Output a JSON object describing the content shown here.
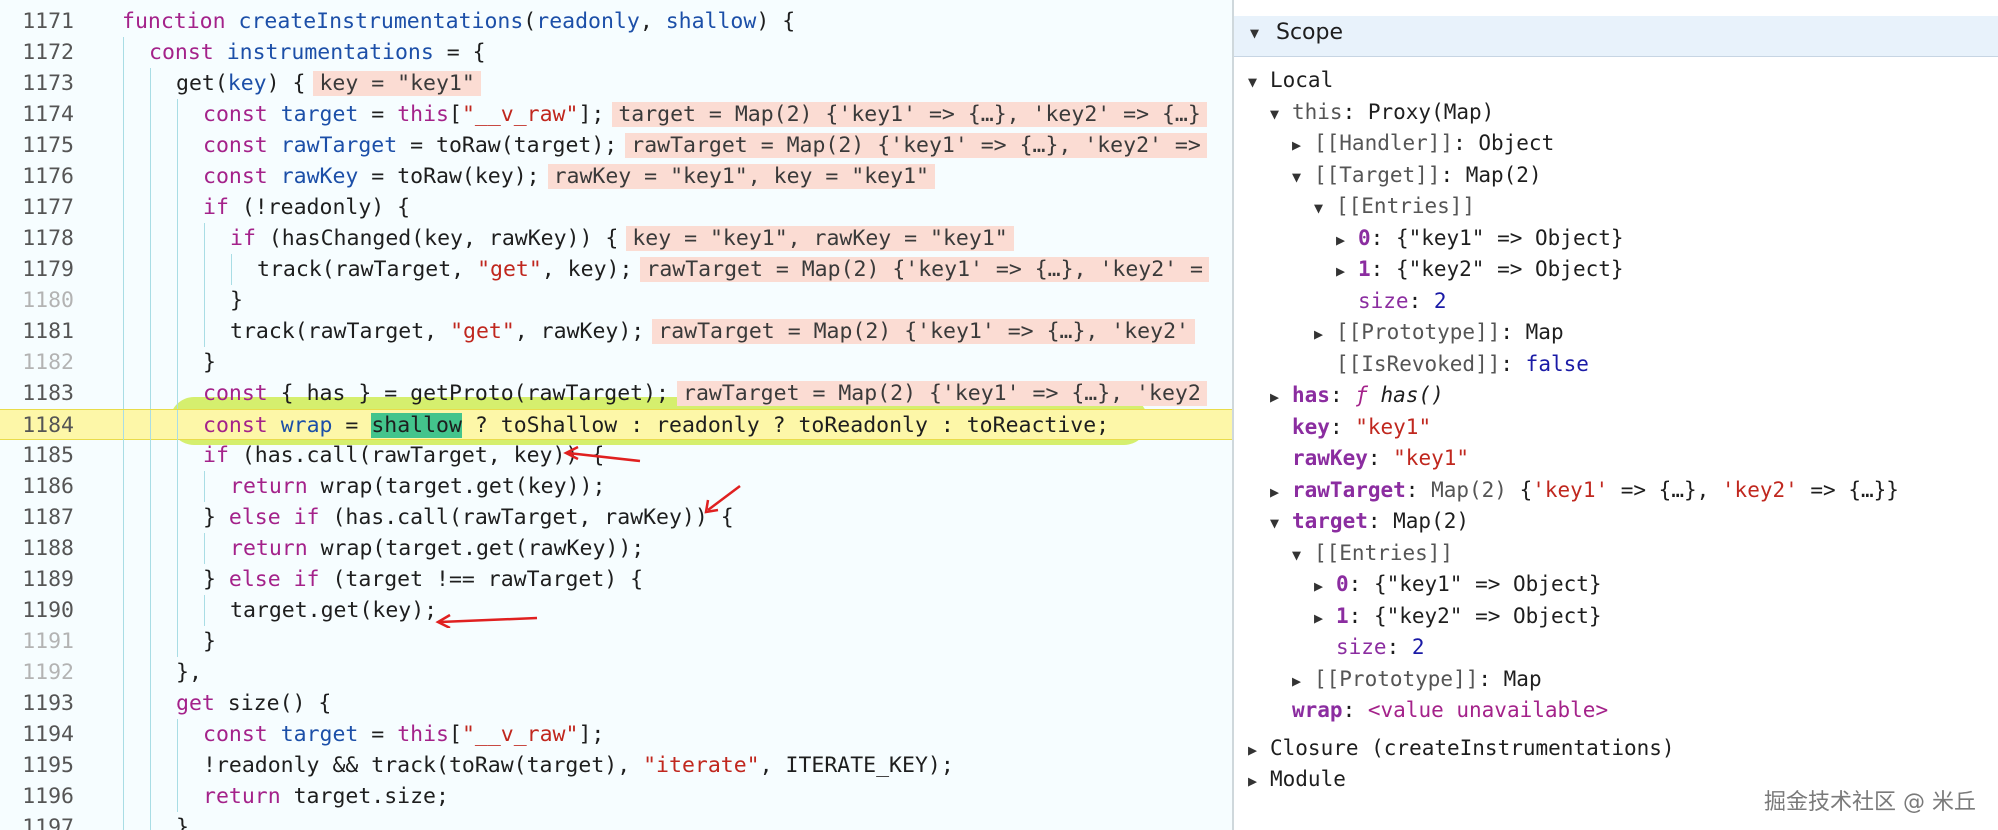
{
  "editor": {
    "lines": [
      {
        "n": "1171",
        "dim": false,
        "indent": 0,
        "html": "<span class='kw'>function</span> <span class='fn'>createInstrumentations</span>(<span class='fn'>readonly</span>, <span class='fn'>shallow</span>) {"
      },
      {
        "n": "1172",
        "dim": false,
        "indent": 1,
        "html": "<span class='kw'>const</span> <span class='fn'>instrumentations</span> = {"
      },
      {
        "n": "1173",
        "dim": false,
        "indent": 2,
        "html": "get(<span class='fn'>key</span>) {<span class='inl'>key = \"key1\"</span>"
      },
      {
        "n": "1174",
        "dim": false,
        "indent": 3,
        "html": "<span class='kw'>const</span> <span class='fn'>target</span> = <span class='kw'>this</span>[<span class='str'>\"__v_raw\"</span>];<span class='inl'>target = Map(2) {'key1' =&gt; {…}, 'key2' =&gt; {…}</span>"
      },
      {
        "n": "1175",
        "dim": false,
        "indent": 3,
        "html": "<span class='kw'>const</span> <span class='fn'>rawTarget</span> = toRaw(target);<span class='inl'>rawTarget = Map(2) {'key1' =&gt; {…}, 'key2' =&gt;</span>"
      },
      {
        "n": "1176",
        "dim": false,
        "indent": 3,
        "html": "<span class='kw'>const</span> <span class='fn'>rawKey</span> = toRaw(key);<span class='inl'>rawKey = \"key1\", key = \"key1\"</span>"
      },
      {
        "n": "1177",
        "dim": false,
        "indent": 3,
        "html": "<span class='kw'>if</span> (!readonly) {"
      },
      {
        "n": "1178",
        "dim": false,
        "indent": 4,
        "html": "<span class='kw'>if</span> (hasChanged(key, rawKey)) {<span class='inl'>key = \"key1\", rawKey = \"key1\"</span>"
      },
      {
        "n": "1179",
        "dim": false,
        "indent": 5,
        "html": "track(rawTarget, <span class='str'>\"get\"</span>, key);<span class='inl'>rawTarget = Map(2) {'key1' =&gt; {…}, 'key2' =</span>"
      },
      {
        "n": "1180",
        "dim": true,
        "indent": 4,
        "html": "}"
      },
      {
        "n": "1181",
        "dim": false,
        "indent": 4,
        "html": "track(rawTarget, <span class='str'>\"get\"</span>, rawKey);<span class='inl'>rawTarget = Map(2) {'key1' =&gt; {…}, 'key2'</span>"
      },
      {
        "n": "1182",
        "dim": true,
        "indent": 3,
        "html": "}"
      },
      {
        "n": "1183",
        "dim": false,
        "indent": 3,
        "html": "<span class='kw'>const</span> { has } = getProto(rawTarget);<span class='inl'>rawTarget = Map(2) {'key1' =&gt; {…}, 'key2</span>"
      },
      {
        "n": "1184",
        "dim": false,
        "indent": 3,
        "hl": true,
        "html": "<span class='kw'>const</span> <span class='fn'>wrap</span> = <span class='shallow-sel'>shallow</span> ? toShallow : readonly ? toReadonly : toReactive;"
      },
      {
        "n": "1185",
        "dim": false,
        "indent": 3,
        "html": "<span class='kw'>if</span> (has.call(rawTarget, key)) {"
      },
      {
        "n": "1186",
        "dim": false,
        "indent": 4,
        "html": "<span class='kw'>return</span> wrap(target.get(key));"
      },
      {
        "n": "1187",
        "dim": false,
        "indent": 3,
        "html": "} <span class='kw'>else if</span> (has.call(rawTarget, rawKey)) {"
      },
      {
        "n": "1188",
        "dim": false,
        "indent": 4,
        "html": "<span class='kw'>return</span> wrap(target.get(rawKey));"
      },
      {
        "n": "1189",
        "dim": false,
        "indent": 3,
        "html": "} <span class='kw'>else if</span> (target !== rawTarget) {"
      },
      {
        "n": "1190",
        "dim": false,
        "indent": 4,
        "html": "target.get(key);"
      },
      {
        "n": "1191",
        "dim": true,
        "indent": 3,
        "html": "}"
      },
      {
        "n": "1192",
        "dim": true,
        "indent": 2,
        "html": "},"
      },
      {
        "n": "1193",
        "dim": false,
        "indent": 2,
        "html": "<span class='kw'>get</span> size() {"
      },
      {
        "n": "1194",
        "dim": false,
        "indent": 3,
        "html": "<span class='kw'>const</span> <span class='fn'>target</span> = <span class='kw'>this</span>[<span class='str'>\"__v_raw\"</span>];"
      },
      {
        "n": "1195",
        "dim": false,
        "indent": 3,
        "html": "!readonly &amp;&amp; track(toRaw(target), <span class='str'>\"iterate\"</span>, ITERATE_KEY);"
      },
      {
        "n": "1196",
        "dim": false,
        "indent": 3,
        "html": "<span class='kw'>return</span> target.size;"
      },
      {
        "n": "1197",
        "dim": false,
        "indent": 2,
        "html": "},"
      }
    ]
  },
  "scope": {
    "header": "Scope",
    "rows": [
      {
        "indent": 0,
        "tri": "▼",
        "html": "Local"
      },
      {
        "indent": 1,
        "tri": "▼",
        "html": "<span class='gray'>this</span>: Proxy(Map)"
      },
      {
        "indent": 2,
        "tri": "▶",
        "html": "<span class='gray'>[[Handler]]</span>: Object"
      },
      {
        "indent": 2,
        "tri": "▼",
        "html": "<span class='gray'>[[Target]]</span>: Map(2)"
      },
      {
        "indent": 3,
        "tri": "▼",
        "html": "<span class='gray'>[[Entries]]</span>"
      },
      {
        "indent": 4,
        "tri": "▶",
        "html": "<span class='keyb'>0</span>: {\"key1\" =&gt; Object}"
      },
      {
        "indent": 4,
        "tri": "▶",
        "html": "<span class='keyb'>1</span>: {\"key2\" =&gt; Object}"
      },
      {
        "indent": 4,
        "tri": "",
        "html": "<span class='key'>size</span>: <span class='nval'>2</span>"
      },
      {
        "indent": 3,
        "tri": "▶",
        "html": "<span class='gray'>[[Prototype]]</span>: Map"
      },
      {
        "indent": 3,
        "tri": "",
        "html": "<span class='gray'>[[IsRevoked]]</span>: <span class='bval'>false</span>"
      },
      {
        "indent": 1,
        "tri": "▶",
        "html": "<span class='keyb'>has</span>: <span class='italic'><span class='kw'>ƒ</span> has()</span>"
      },
      {
        "indent": 1,
        "tri": "",
        "html": "<span class='keyb'>key</span>: <span class='sval'>\"key1\"</span>"
      },
      {
        "indent": 1,
        "tri": "",
        "html": "<span class='keyb'>rawKey</span>: <span class='sval'>\"key1\"</span>"
      },
      {
        "indent": 1,
        "tri": "▶",
        "html": "<span class='keyb'>rawTarget</span>: <span class='gray'>Map(2)</span> {<span class='sval'>'key1'</span> =&gt; {…}, <span class='sval'>'key2'</span> =&gt; {…}}"
      },
      {
        "indent": 1,
        "tri": "▼",
        "html": "<span class='keyb'>target</span>: Map(2)"
      },
      {
        "indent": 2,
        "tri": "▼",
        "html": "<span class='gray'>[[Entries]]</span>"
      },
      {
        "indent": 3,
        "tri": "▶",
        "html": "<span class='keyb'>0</span>: {\"key1\" =&gt; Object}"
      },
      {
        "indent": 3,
        "tri": "▶",
        "html": "<span class='keyb'>1</span>: {\"key2\" =&gt; Object}"
      },
      {
        "indent": 3,
        "tri": "",
        "html": "<span class='key'>size</span>: <span class='nval'>2</span>"
      },
      {
        "indent": 2,
        "tri": "▶",
        "html": "<span class='gray'>[[Prototype]]</span>: Map"
      },
      {
        "indent": 1,
        "tri": "",
        "html": "<span class='keyb'>wrap</span>: <span class='kw'>&lt;value unavailable&gt;</span>"
      },
      {
        "indent": 0,
        "tri": "▶",
        "html": "Closure (createInstrumentations)"
      },
      {
        "indent": 0,
        "tri": "▶",
        "html": "Module"
      }
    ]
  },
  "watermark": "掘金技术社区 @ 米丘"
}
